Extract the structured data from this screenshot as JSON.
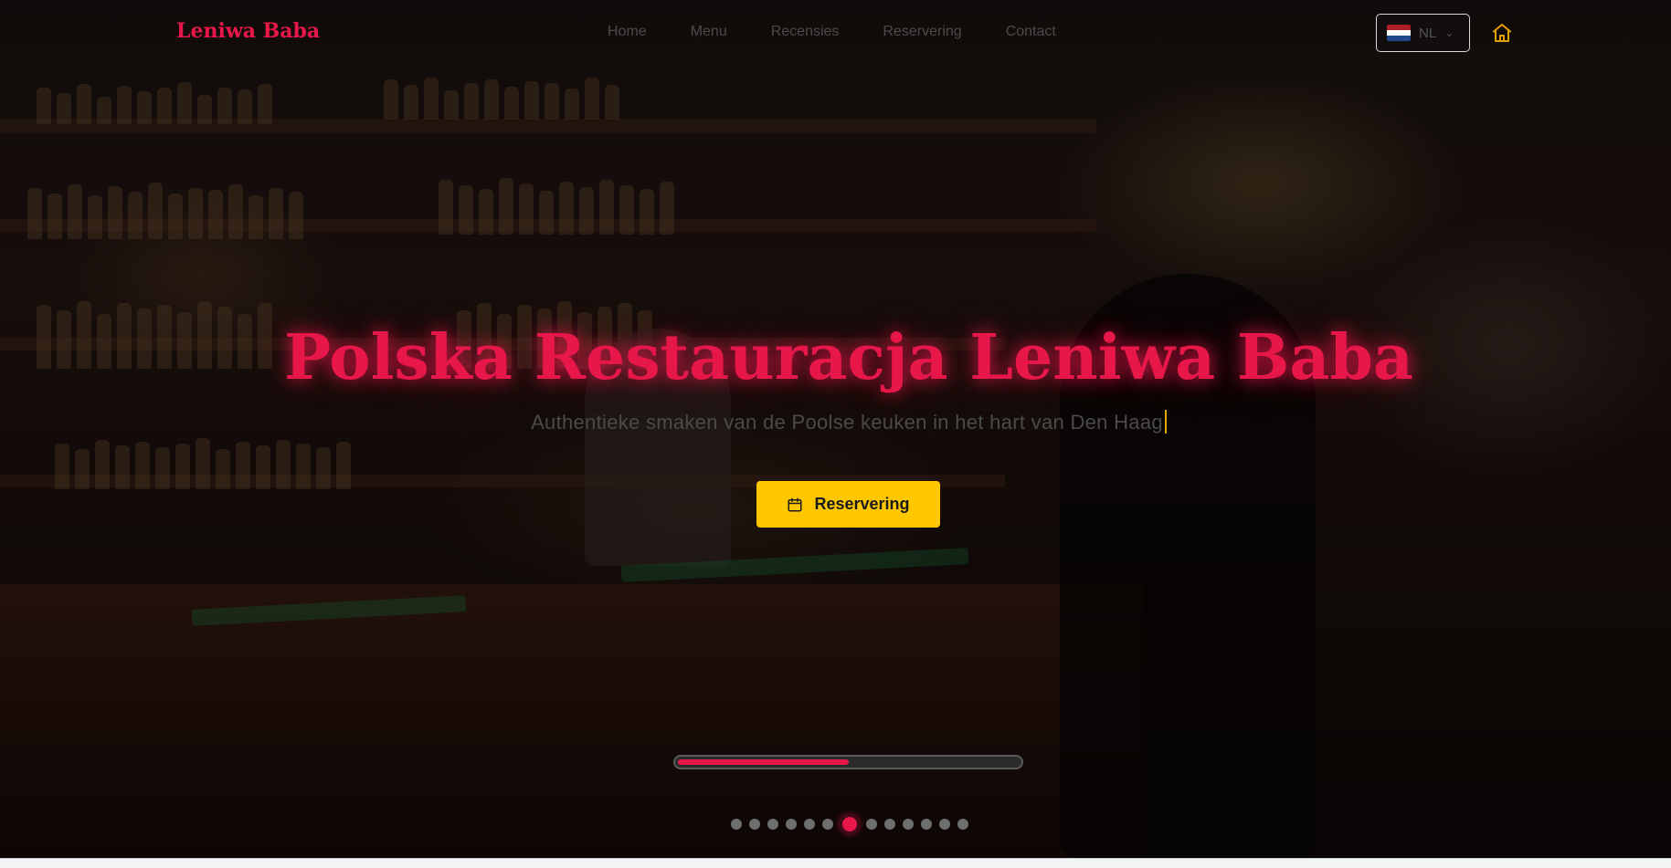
{
  "brand": {
    "logo_text": "Leniwa Baba",
    "accent_color": "#e8174a",
    "cta_color": "#ffc700"
  },
  "nav": {
    "items": [
      {
        "label": "Home"
      },
      {
        "label": "Menu"
      },
      {
        "label": "Recensies"
      },
      {
        "label": "Reservering"
      },
      {
        "label": "Contact"
      }
    ],
    "language": {
      "code": "NL",
      "flag": "netherlands-flag-icon"
    },
    "home_icon": "home-icon"
  },
  "hero": {
    "title": "Polska Restauracja Leniwa Baba",
    "subtitle": "Authentieke smaken van de Poolse keuken in het hart van Den Haag",
    "cta_label": "Reservering",
    "cta_icon": "calendar-icon"
  },
  "slider": {
    "progress_fraction": 0.5,
    "dot_count": 13,
    "active_index": 6
  }
}
